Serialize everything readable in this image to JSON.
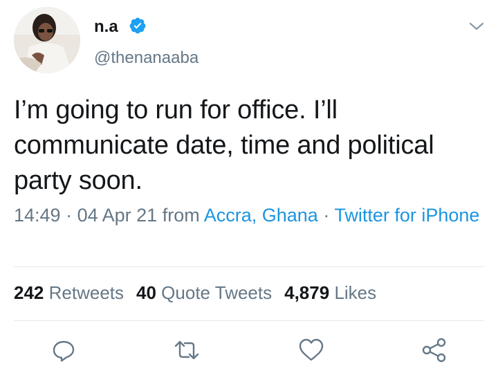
{
  "author": {
    "name": "n.a",
    "handle": "@thenanaaba",
    "verified": true
  },
  "tweet": {
    "text": "I’m going to run for office. I’ll communicate date, time and political party soon.",
    "time": "14:49",
    "date": "04 Apr 21",
    "from_word": "from",
    "location": "Accra, Ghana",
    "separator": "·",
    "client": "Twitter for iPhone"
  },
  "stats": {
    "retweets": {
      "count": "242",
      "label": "Retweets"
    },
    "quote_tweets": {
      "count": "40",
      "label": "Quote Tweets"
    },
    "likes": {
      "count": "4,879",
      "label": "Likes"
    }
  },
  "icons": {
    "verified": "verified-badge-icon",
    "menu": "chevron-down-icon",
    "reply": "reply-icon",
    "retweet": "retweet-icon",
    "like": "heart-icon",
    "share": "share-icon"
  },
  "colors": {
    "link": "#1b95e0",
    "secondary_text": "#657786",
    "primary_text": "#14171a",
    "verified": "#1da1f2"
  }
}
